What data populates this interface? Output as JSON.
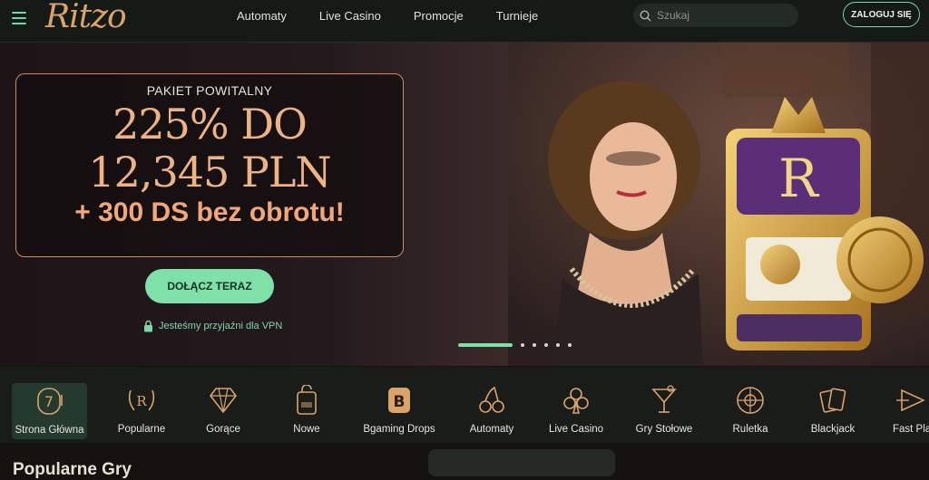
{
  "header": {
    "logo": "Ritzo",
    "nav": [
      "Automaty",
      "Live Casino",
      "Promocje",
      "Turnieje"
    ],
    "search_placeholder": "Szukaj",
    "login_label": "ZALOGUJ SIĘ"
  },
  "hero": {
    "label": "PAKIET POWITALNY",
    "amount_line1": "225% DO",
    "amount_line2": "12,345 PLN",
    "extra": "+ 300 DS bez obrotu!",
    "cta": "DOŁĄCZ TERAZ",
    "vpn_text": "Jesteśmy przyjaźni dla VPN",
    "slides_total": 6,
    "slide_active": 1
  },
  "categories": [
    {
      "label": "Strona Główna",
      "icon": "slot-seven-icon",
      "active": true
    },
    {
      "label": "Popularne",
      "icon": "laurel-badge-icon"
    },
    {
      "label": "Gorące",
      "icon": "diamond-icon"
    },
    {
      "label": "Nowe",
      "icon": "new-tag-icon"
    },
    {
      "label": "Bgaming Drops",
      "icon": "bgaming-b-icon"
    },
    {
      "label": "Automaty",
      "icon": "cherries-icon"
    },
    {
      "label": "Live Casino",
      "icon": "club-suit-icon"
    },
    {
      "label": "Gry Stołowe",
      "icon": "cocktail-glass-icon"
    },
    {
      "label": "Ruletka",
      "icon": "roulette-icon"
    },
    {
      "label": "Blackjack",
      "icon": "cards-icon"
    },
    {
      "label": "Fast Pla",
      "icon": "fast-play-icon"
    }
  ],
  "section": {
    "title": "Popularne Gry"
  },
  "colors": {
    "accent": "#7fe0a8",
    "promo_text": "#eeb384",
    "background": "#14110f"
  }
}
